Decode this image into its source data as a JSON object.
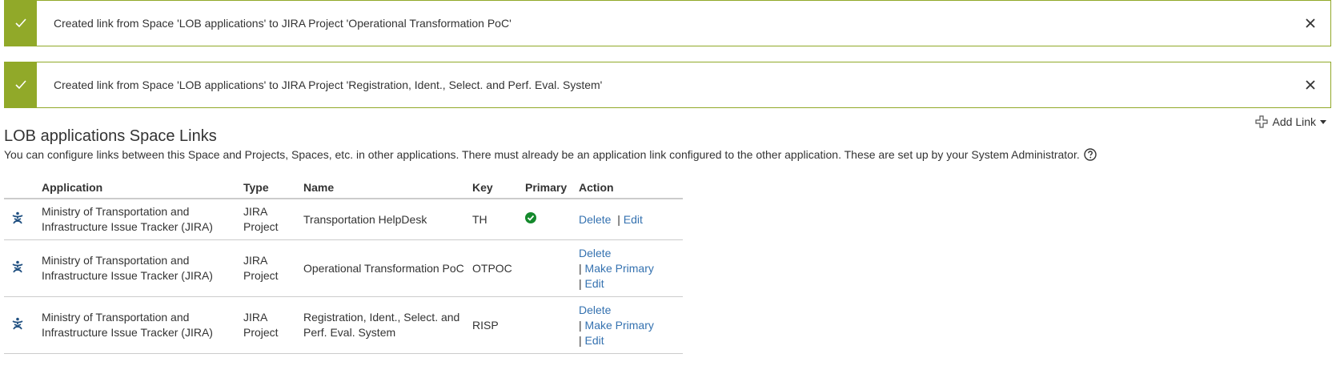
{
  "messages": [
    {
      "text": "Created link from Space 'LOB applications' to JIRA Project 'Operational Transformation PoC'"
    },
    {
      "text": "Created link from Space 'LOB applications' to JIRA Project 'Registration, Ident., Select. and Perf. Eval. System'"
    }
  ],
  "page": {
    "title": "LOB applications Space Links",
    "description": "You can configure links between this Space and Projects, Spaces, etc. in other applications. There must already be an application link configured to the other application. These are set up by your System Administrator.",
    "add_link_label": "Add Link"
  },
  "table": {
    "headers": {
      "application": "Application",
      "type": "Type",
      "name": "Name",
      "key": "Key",
      "primary": "Primary",
      "action": "Action"
    },
    "rows": [
      {
        "icon": "jira-icon",
        "application_line1": "Ministry of Transportation and",
        "application_line2": "Infrastructure Issue Tracker (JIRA)",
        "type_line1": "JIRA",
        "type_line2": "Project",
        "name_line1": "Transportation HelpDesk",
        "name_line2": "",
        "key": "TH",
        "primary": true,
        "delete_label": "Delete",
        "edit_label": "Edit"
      },
      {
        "icon": "jira-icon",
        "application_line1": "Ministry of Transportation and",
        "application_line2": "Infrastructure Issue Tracker (JIRA)",
        "type_line1": "JIRA",
        "type_line2": "Project",
        "name_line1": "Operational Transformation PoC",
        "name_line2": "",
        "key": "OTPOC",
        "primary": false,
        "delete_label": "Delete",
        "make_primary_label": "Make Primary",
        "edit_label": "Edit"
      },
      {
        "icon": "jira-icon",
        "application_line1": "Ministry of Transportation and",
        "application_line2": "Infrastructure Issue Tracker (JIRA)",
        "type_line1": "JIRA",
        "type_line2": "Project",
        "name_line1": "Registration, Ident., Select. and",
        "name_line2": "Perf. Eval. System",
        "key": "RISP",
        "primary": false,
        "delete_label": "Delete",
        "make_primary_label": "Make Primary",
        "edit_label": "Edit"
      }
    ],
    "separator": "|"
  },
  "colors": {
    "success": "#91a929",
    "link": "#3572b0",
    "primary_check": "#14892c",
    "jira_icon": "#205081"
  }
}
